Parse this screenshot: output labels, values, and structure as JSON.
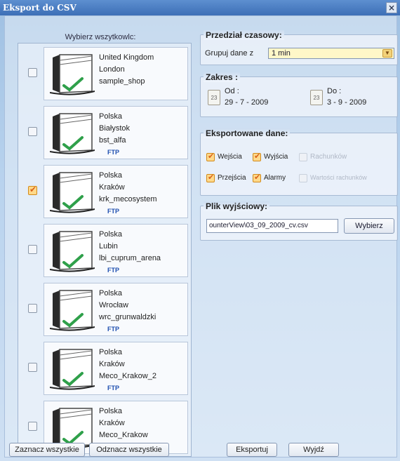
{
  "window": {
    "title": "Eksport do CSV",
    "close_glyph": "×"
  },
  "shops": {
    "caption": "Wybierz wszytkowlc:",
    "items": [
      {
        "country": "United Kingdom",
        "city": "London",
        "code": "sample_shop",
        "ftp": "",
        "checked": false
      },
      {
        "country": "Polska",
        "city": "Białystok",
        "code": "bst_alfa",
        "ftp": "FTP",
        "checked": false
      },
      {
        "country": "Polska",
        "city": "Kraków",
        "code": "krk_mecosystem",
        "ftp": "FTP",
        "checked": true
      },
      {
        "country": "Polska",
        "city": "Lubin",
        "code": "lbi_cuprum_arena",
        "ftp": "FTP",
        "checked": false
      },
      {
        "country": "Polska",
        "city": "Wrocław",
        "code": "wrc_grunwaldzki",
        "ftp": "FTP",
        "checked": false
      },
      {
        "country": "Polska",
        "city": "Kraków",
        "code": "Meco_Krakow_2",
        "ftp": "FTP",
        "checked": false
      },
      {
        "country": "Polska",
        "city": "Kraków",
        "code": "Meco_Krakow",
        "ftp": "",
        "checked": false
      }
    ]
  },
  "time_range": {
    "title": "Przedział czasowy:",
    "group_label": "Grupuj dane z",
    "group_value": "1 min"
  },
  "scope": {
    "title": "Zakres :",
    "from_label": "Od :",
    "from_date": "29 - 7 - 2009",
    "to_label": "Do :",
    "to_date": "3 - 9 - 2009",
    "calendar_day": "23"
  },
  "exported": {
    "title": "Eksportowane dane:",
    "entries_label": "Wejścia",
    "exits_label": "Wyjścia",
    "receipts_label": "Rachunków",
    "passages_label": "Przejścia",
    "alarms_label": "Alarmy",
    "receipt_values_label": "Wartości rachunków"
  },
  "output": {
    "title": "Plik wyjściowy:",
    "path": "ounterView\\03_09_2009_cv.csv",
    "pick_label": "Wybierz"
  },
  "buttons": {
    "select_all": "Zaznacz wszystkie",
    "deselect_all": "Odznacz wszystkie",
    "export": "Eksportuj",
    "exit": "Wyjdź"
  }
}
